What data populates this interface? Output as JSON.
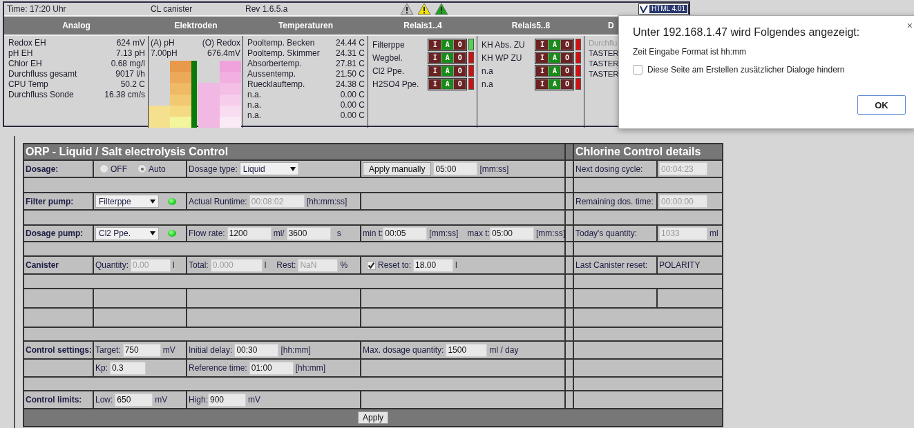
{
  "status_bar": {
    "time": "Time: 17:20 Uhr",
    "mode": "CL canister",
    "revision": "Rev 1.6.5.a",
    "alerts": [
      {
        "color": "#c0c0c0"
      },
      {
        "color": "#f2e200"
      },
      {
        "color": "#1ea31e"
      }
    ],
    "badge": "HTML 4.01"
  },
  "analog": {
    "header": "Analog",
    "rows": [
      {
        "label": "Redox EH",
        "value": "624 mV"
      },
      {
        "label": "pH EH",
        "value": "7.13 pH"
      },
      {
        "label": "Chlor EH",
        "value": "0.68 mg/l"
      },
      {
        "label": "Durchfluss gesamt",
        "value": "9017 l/h"
      },
      {
        "label": "CPU Temp",
        "value": "50.2 C"
      },
      {
        "label": "Durchfluss Sonde",
        "value": "16.38 cm/s"
      }
    ]
  },
  "electrodes": {
    "header": "Elektroden",
    "ph_label": "(A) pH",
    "redox_label": "(O) Redox",
    "ph_value": "7.00pH",
    "redox_value": "676.4mV"
  },
  "temperatures": {
    "header": "Temperaturen",
    "rows": [
      {
        "label": "Pooltemp. Becken",
        "value": "24.44 C"
      },
      {
        "label": "Pooltemp. Skimmer",
        "value": "24.31 C"
      },
      {
        "label": "Absorbertemp.",
        "value": "27.81 C"
      },
      {
        "label": "Aussentemp.",
        "value": "21.50 C"
      },
      {
        "label": "Ruecklauftemp.",
        "value": "24.38 C"
      },
      {
        "label": "n.a.",
        "value": "0.00 C"
      },
      {
        "label": "n.a.",
        "value": "0.00 C"
      },
      {
        "label": "n.a.",
        "value": "0.00 C"
      }
    ]
  },
  "relays": [
    {
      "header": "Relais1..4",
      "items": [
        {
          "label": "Filterppe",
          "on": true,
          "modes": [
            {
              "label": "I",
              "selected": false
            },
            {
              "label": "A",
              "selected": true
            },
            {
              "label": "O",
              "selected": false
            }
          ]
        },
        {
          "label": "Wegbel.",
          "on": false,
          "modes": [
            {
              "label": "I",
              "selected": false
            },
            {
              "label": "A",
              "selected": true
            },
            {
              "label": "O",
              "selected": false
            }
          ]
        },
        {
          "label": "Cl2 Ppe.",
          "on": false,
          "modes": [
            {
              "label": "I",
              "selected": false
            },
            {
              "label": "A",
              "selected": true
            },
            {
              "label": "O",
              "selected": false
            }
          ]
        },
        {
          "label": "H2SO4 Ppe.",
          "on": false,
          "modes": [
            {
              "label": "I",
              "selected": false
            },
            {
              "label": "A",
              "selected": true
            },
            {
              "label": "O",
              "selected": false
            }
          ]
        }
      ]
    },
    {
      "header": "Relais5..8",
      "items": [
        {
          "label": "KH Abs. ZU",
          "on": false,
          "modes": [
            {
              "label": "I",
              "selected": false
            },
            {
              "label": "A",
              "selected": true
            },
            {
              "label": "O",
              "selected": false
            }
          ]
        },
        {
          "label": "KH WP ZU",
          "on": false,
          "modes": [
            {
              "label": "I",
              "selected": false
            },
            {
              "label": "A",
              "selected": true
            },
            {
              "label": "O",
              "selected": false
            }
          ]
        },
        {
          "label": "n.a",
          "on": false,
          "modes": [
            {
              "label": "I",
              "selected": false
            },
            {
              "label": "A",
              "selected": true
            },
            {
              "label": "O",
              "selected": false
            }
          ]
        },
        {
          "label": "n.a",
          "on": false,
          "modes": [
            {
              "label": "I",
              "selected": false
            },
            {
              "label": "A",
              "selected": true
            },
            {
              "label": "O",
              "selected": false
            }
          ]
        }
      ]
    }
  ],
  "column_6": {
    "header": "D",
    "items": [
      {
        "label": "Durchflu",
        "disabled": true
      },
      {
        "label": "TASTER",
        "disabled": false
      },
      {
        "label": "TASTER",
        "disabled": false
      },
      {
        "label": "TASTER",
        "disabled": false
      }
    ]
  },
  "dialog": {
    "title": "Unter 192.168.1.47 wird Folgendes angezeigt:",
    "message": "Zeit Eingabe Format ist hh:mm",
    "checkbox_label": "Diese Seite am Erstellen zusätzlicher Dialoge hindern",
    "checked": false,
    "ok": "OK",
    "close": "×"
  },
  "orp": {
    "title": "ORP - Liquid / Salt electrolysis Control",
    "dosage": {
      "label": "Dosage:",
      "options": [
        {
          "label": "OFF",
          "selected": false
        },
        {
          "label": "Auto",
          "selected": true
        }
      ],
      "type_label": "Dosage type:",
      "type_value": "Liquid",
      "apply_button": "Apply manually",
      "manual_time": {
        "value": "05:00",
        "disabled": false
      },
      "manual_unit": "[mm:ss]"
    },
    "filter_pump": {
      "label": "Filter pump:",
      "pump": "Filterppe",
      "running": true,
      "runtime_label": "Actual Runtime:",
      "runtime": {
        "value": "00:08:02",
        "disabled": true
      },
      "runtime_unit": "[hh:mm:ss]"
    },
    "dosage_pump": {
      "label": "Dosage pump:",
      "pump": "Cl2 Ppe.",
      "running": true,
      "flow_label": "Flow rate:",
      "flow_ml": {
        "value": "1200",
        "disabled": false
      },
      "flow_ml_unit": "ml/",
      "flow_s": {
        "value": "3600",
        "disabled": false
      },
      "flow_s_unit": "s",
      "min_label": "min t:",
      "min_value": {
        "value": "00:05",
        "disabled": false
      },
      "min_unit": "[mm:ss]",
      "max_label": "max t:",
      "max_value": {
        "value": "05:00",
        "disabled": false
      },
      "max_unit": "[mm:ss]"
    },
    "canister": {
      "label": "Canister",
      "quantity_label": "Quantity:",
      "quantity": {
        "value": "0.00",
        "disabled": true
      },
      "quantity_unit": "l",
      "total_label": "Total:",
      "total": {
        "value": "0.000",
        "disabled": true
      },
      "total_unit": "l",
      "rest_label": "Rest:",
      "rest": {
        "value": "NaN",
        "disabled": true
      },
      "rest_unit": "%",
      "reset_checked": true,
      "reset_label": "Reset to:",
      "reset_value": {
        "value": "18.00",
        "disabled": false
      },
      "reset_unit": "l"
    },
    "control_settings": {
      "label": "Control settings:",
      "target_label": "Target:",
      "target": {
        "value": "750",
        "disabled": false
      },
      "target_unit": "mV",
      "delay_label": "Initial delay:",
      "delay": {
        "value": "00:30",
        "disabled": false
      },
      "delay_unit": "[hh:mm]",
      "max_label": "Max. dosage quantity:",
      "max": {
        "value": "1500",
        "disabled": false
      },
      "max_unit": "ml / day",
      "kp_label": "Kp:",
      "kp": {
        "value": "0.3",
        "disabled": false
      },
      "ref_label": "Reference time:",
      "ref": {
        "value": "01:00",
        "disabled": false
      },
      "ref_unit": "[hh:mm]"
    },
    "control_limits": {
      "label": "Control limits:",
      "low_label": "Low:",
      "low": {
        "value": "650",
        "disabled": false
      },
      "low_unit": "mV",
      "high_label": "High:",
      "high": {
        "value": "900",
        "disabled": false
      },
      "high_unit": "mV"
    },
    "apply_button": "Apply"
  },
  "details": {
    "title": "Chlorine Control details",
    "next_label": "Next dosing cycle:",
    "next": {
      "value": "00:04:23",
      "disabled": true
    },
    "remaining_label": "Remaining dos. time:",
    "remaining": {
      "value": "00:00:00",
      "disabled": true
    },
    "today_label": "Today's quantity:",
    "today": {
      "value": "1033",
      "disabled": true
    },
    "today_unit": "ml",
    "reset_label": "Last Canister reset:",
    "reset_value": "POLARITY"
  }
}
